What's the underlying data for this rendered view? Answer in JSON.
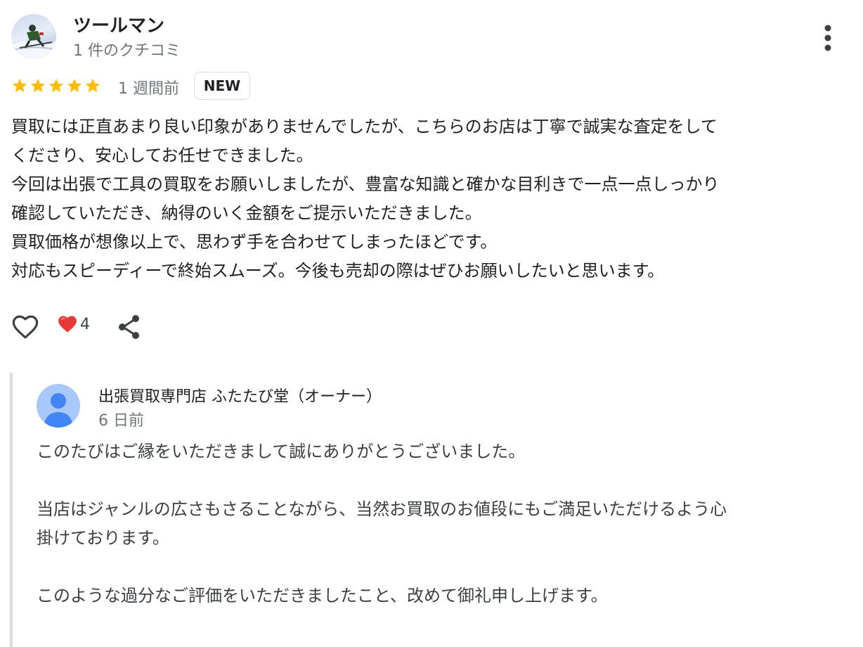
{
  "review": {
    "reviewer_name": "ツールマン",
    "review_count": "1 件のクチコミ",
    "rating": 5,
    "time": "1 週間前",
    "badge": "NEW",
    "text_lines": [
      "買取には正直あまり良い印象がありませんでしたが、こちらのお店は丁寧で誠実な査定をして",
      "くださり、安心してお任せできました。",
      "今回は出張で工具の買取をお願いしましたが、豊富な知識と確かな目利きで一点一点しっかり",
      "確認していただき、納得のいく金額をご提示いただきました。",
      "買取価格が想像以上で、思わず手を合わせてしまったほどです。",
      "対応もスピーディーで終始スムーズ。今後も売却の際はぜひお願いしたいと思います。"
    ]
  },
  "actions": {
    "like_icon": "heart-outline-icon",
    "reaction_icon": "red-heart-icon",
    "reaction_count": "4",
    "share_icon": "share-icon",
    "more_icon": "more-vert-icon"
  },
  "owner_reply": {
    "name": "出張買取専門店 ふたたび堂（オーナー）",
    "time": "6 日前",
    "paragraphs": [
      [
        "このたびはご縁をいただきまして誠にありがとうございました。"
      ],
      [
        "当店はジャンルの広さもさることながら、当然お買取のお値段にもご満足いただけるよう心",
        "掛けております。"
      ],
      [
        "このような過分なご評価をいただきましたこと、改めて御礼申し上げます。"
      ]
    ]
  },
  "colors": {
    "star": "#fbbc04",
    "reaction_heart": "#e53935",
    "text_primary": "#202124",
    "text_secondary": "#70757a",
    "reply_bar": "#dadce0",
    "owner_avatar": "#a8c7fa",
    "owner_avatar_figure": "#4285f4"
  }
}
